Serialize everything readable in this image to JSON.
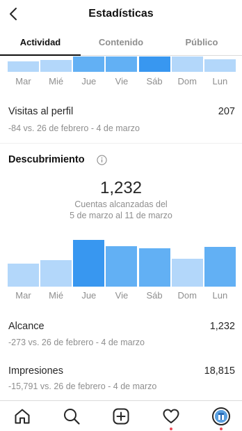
{
  "header": {
    "title": "Estadísticas"
  },
  "tabs": [
    {
      "label": "Actividad",
      "active": true
    },
    {
      "label": "Contenido",
      "active": false
    },
    {
      "label": "Público",
      "active": false
    }
  ],
  "colors": {
    "bar_dark": "#3897f0",
    "bar_mid": "#62b0f4",
    "bar_light": "#b3d7fa",
    "text_primary": "#262626",
    "text_secondary": "#8e8e8e",
    "notification": "#ed4956"
  },
  "top_chart": {
    "days": [
      "Mar",
      "Mié",
      "Jue",
      "Vie",
      "Sáb",
      "Dom",
      "Lun"
    ],
    "highlight_day": "Sáb"
  },
  "profile_visits": {
    "label": "Visitas al perfil",
    "value": "207",
    "comparison": "-84 vs. 26 de febrero - 4 de marzo"
  },
  "discovery": {
    "title": "Descubrimiento",
    "info_icon": "info-icon",
    "accounts_reached": "1,232",
    "caption_line1": "Cuentas alcanzadas del",
    "caption_line2": "5 de marzo al 11 de marzo",
    "chart": {
      "days": [
        "Mar",
        "Mié",
        "Jue",
        "Vie",
        "Sáb",
        "Dom",
        "Lun"
      ],
      "relative_values": [
        0.49,
        0.57,
        1.0,
        0.87,
        0.82,
        0.6,
        0.85
      ],
      "highlight_day": "Jue"
    }
  },
  "reach": {
    "label": "Alcance",
    "value": "1,232",
    "comparison": "-273 vs. 26 de febrero - 4 de marzo"
  },
  "impressions": {
    "label": "Impresiones",
    "value": "18,815",
    "comparison": "-15,791 vs. 26 de febrero - 4 de marzo"
  },
  "tabbar": {
    "items": [
      "home-icon",
      "search-icon",
      "new-post-icon",
      "activity-heart-icon",
      "profile-avatar"
    ]
  }
}
